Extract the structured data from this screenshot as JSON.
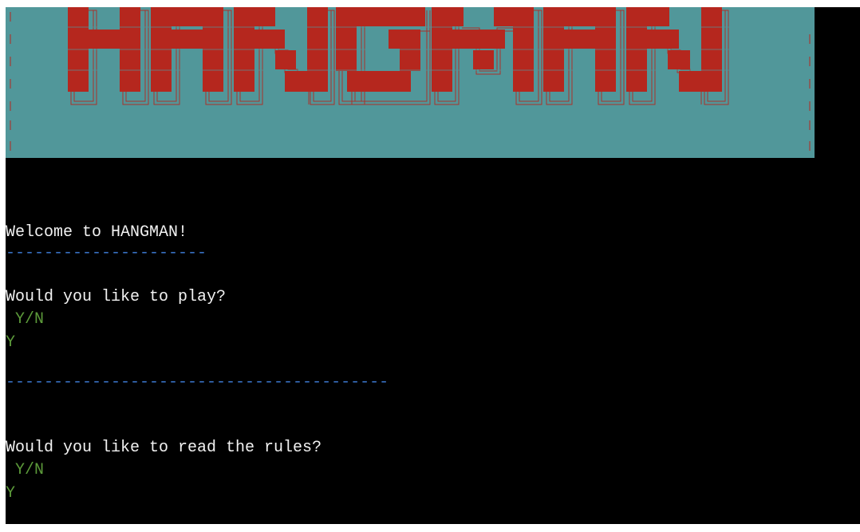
{
  "banner": {
    "art_text": "HANGMAN",
    "colors": {
      "background": "#51979a",
      "letters": "#b5271e",
      "outline": "#b5271e"
    }
  },
  "terminal": {
    "welcome": "Welcome to HANGMAN!",
    "divider_short": "---------------------",
    "play_prompt": "Would you like to play?",
    "play_options": " Y/N",
    "play_answer": "Y",
    "divider_long": "----------------------------------------",
    "rules_prompt": "Would you like to read the rules?",
    "rules_options": " Y/N",
    "rules_answer": "Y"
  }
}
